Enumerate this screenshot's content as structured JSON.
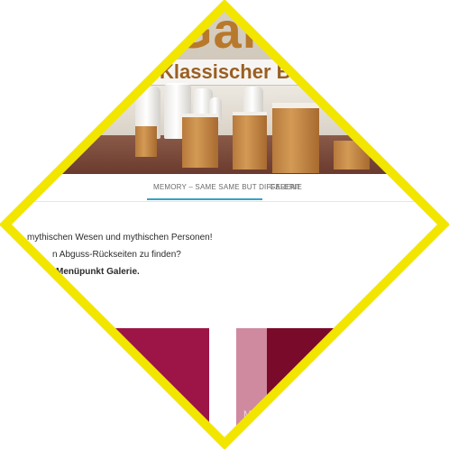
{
  "hero": {
    "title_large": "Gal",
    "subtitle": "Klassischer B"
  },
  "nav": {
    "items": [
      {
        "label": "MEMORY – SAME SAME BUT DIFFERENT",
        "active": true
      },
      {
        "label": "GALERIE",
        "active": false
      }
    ]
  },
  "content": {
    "line1": "mythischen Wesen und mythischen Personen!",
    "line2": "n Abguss-Rückseiten zu finden?",
    "line3": "Menüpunkt Galerie."
  },
  "gallery": {
    "tile_label": "M"
  },
  "colors": {
    "frame": "#f2e600",
    "accent": "#35a3c7",
    "title": "#b8792c",
    "tile_dark": "#9c1546",
    "tile_pink": "#cf8aa0",
    "tile_deep": "#7a0a2a"
  }
}
